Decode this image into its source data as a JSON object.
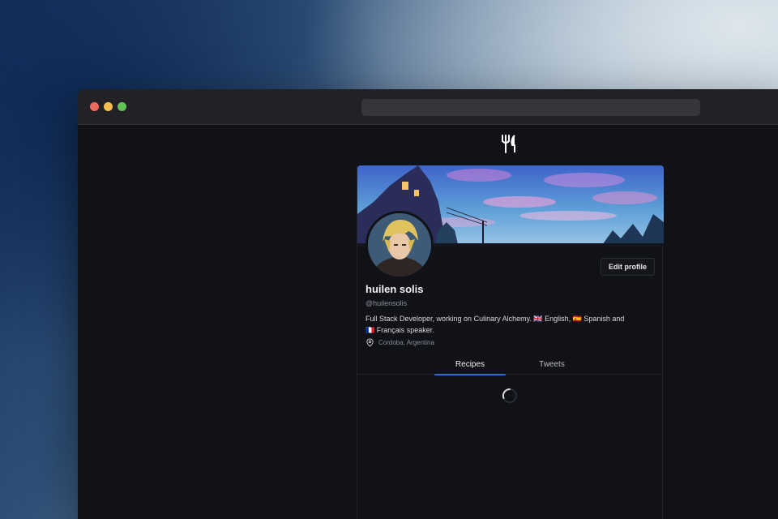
{
  "window": {
    "url": ""
  },
  "app": {
    "logo_icon": "fork-knife-icon"
  },
  "profile": {
    "name": "huilen solis",
    "handle": "@huilensolis",
    "bio_line1": "Full Stack Developer, working on Culinary Alchemy. 🇬🇧 English, 🇪🇸 Spanish and",
    "bio_line2": "🇫🇷 Français speaker.",
    "location": "Cordoba, Argentina",
    "edit_label": "Edit profile"
  },
  "tabs": [
    {
      "label": "Recipes",
      "active": true
    },
    {
      "label": "Tweets",
      "active": false
    }
  ],
  "colors": {
    "accent": "#2f6fd4",
    "background": "#111217"
  }
}
